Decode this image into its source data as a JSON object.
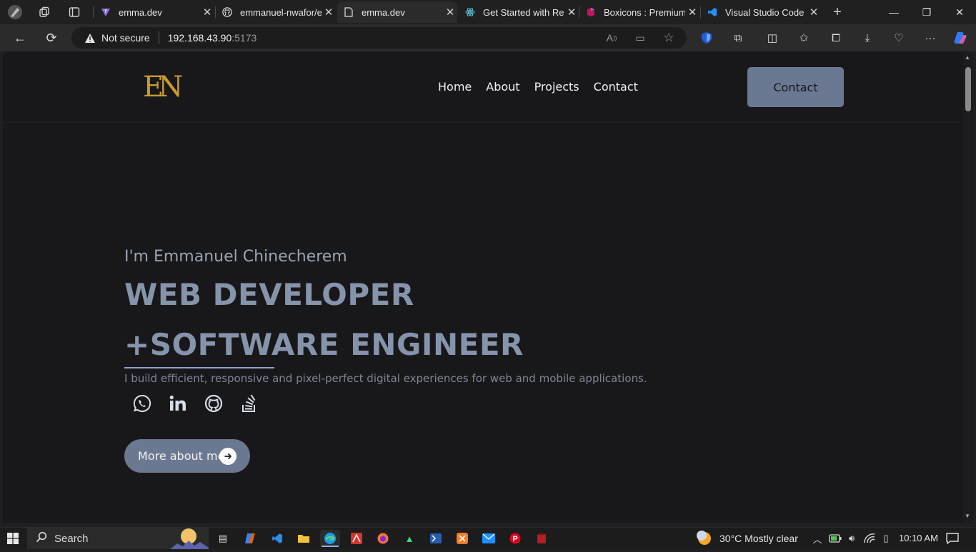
{
  "browser": {
    "tabs": [
      {
        "title": "emma.dev",
        "active": false
      },
      {
        "title": "emmanuel-nwafor/e",
        "active": false
      },
      {
        "title": "emma.dev",
        "active": true
      },
      {
        "title": "Get Started with Rea",
        "active": false
      },
      {
        "title": "Boxicons : Premium",
        "active": false
      },
      {
        "title": "Visual Studio Code I",
        "active": false
      }
    ],
    "address": {
      "security_label": "Not secure",
      "host": "192.168.43.90",
      "port": ":5173"
    }
  },
  "site": {
    "logo_text": "EN",
    "nav": [
      "Home",
      "About",
      "Projects",
      "Contact"
    ],
    "cta_label": "Contact",
    "hero": {
      "greeting": "I'm Emmanuel Chinecherem",
      "title_line1": "WEB DEVELOPER",
      "title_line2": "+SOFTWARE ENGINEER",
      "description": "I build efficient, responsive and pixel-perfect digital experiences for web and mobile applications.",
      "socials": [
        "whatsapp-icon",
        "linkedin-icon",
        "github-icon",
        "stackoverflow-icon"
      ],
      "more_label": "More about me"
    },
    "colors": {
      "background": "#18181b",
      "accent": "#6b7891",
      "heading": "#8694ab",
      "logo": "#c99a2e"
    }
  },
  "taskbar": {
    "search_placeholder": "Search",
    "weather": "30°C  Mostly clear",
    "time": "10:10 AM"
  }
}
